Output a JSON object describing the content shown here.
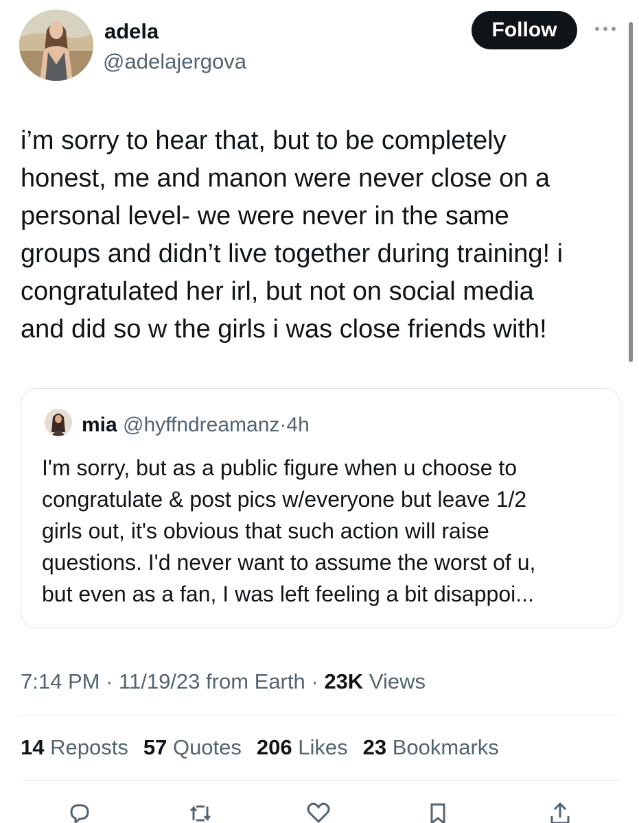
{
  "author": {
    "name": "adela",
    "handle": "@adelajergova"
  },
  "follow_label": "Follow",
  "tweet": {
    "text": "i’m sorry to hear that, but to be completely\nhonest, me and manon were never close on a\npersonal level- we were never in the same\ngroups and didn’t live together during training! i\ncongratulated her irl, but not on social media\nand did so w the girls i was close friends with!"
  },
  "quote": {
    "name": "mia",
    "handle": "@hyffndreamanz",
    "separator": "·",
    "time": "4h",
    "text": "I'm sorry, but as a public figure when u choose to\ncongratulate & post pics w/everyone but leave 1/2\ngirls out, it's obvious that such action will raise\nquestions. I'd never want to assume the worst of u,\nbut even as a fan, I was left feeling a bit disappoi..."
  },
  "meta": {
    "time": "7:14 PM",
    "sep1": "·",
    "date": "11/19/23",
    "source": "from Earth",
    "sep2": "·",
    "views_count": "23K",
    "views_label": "Views"
  },
  "stats": [
    {
      "count": "14",
      "label": "Reposts"
    },
    {
      "count": "57",
      "label": "Quotes"
    },
    {
      "count": "206",
      "label": "Likes"
    },
    {
      "count": "23",
      "label": "Bookmarks"
    }
  ],
  "icons": {
    "more": "more-horizontal-icon",
    "reply": "reply-icon",
    "repost": "repost-icon",
    "like": "heart-icon",
    "bookmark": "bookmark-icon",
    "share": "share-icon"
  },
  "colors": {
    "text": "#0f1419",
    "secondary": "#536471",
    "follow_bg": "#0f1419",
    "border": "#dfe3e6"
  }
}
